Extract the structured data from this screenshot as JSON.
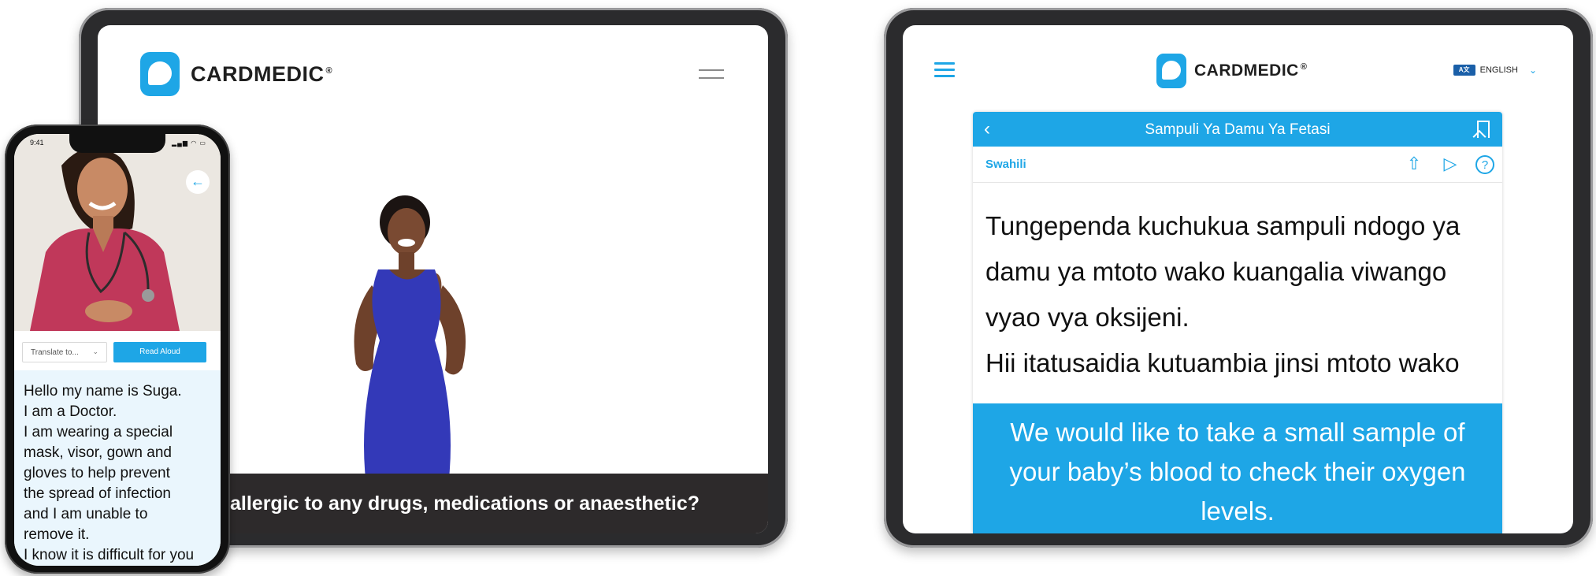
{
  "tablet_video": {
    "brand": "CARDMEDIC",
    "brand_mark": "®",
    "subtitle": "allergic to any drugs, medications or anaesthetic?"
  },
  "phone": {
    "status_time": "9:41",
    "status_icons": "▂▄▆ ◠ ▭",
    "translate_placeholder": "Translate to...",
    "read_aloud_label": "Read Aloud",
    "message_lines": [
      "Hello my name is Suga.",
      "I am a Doctor.",
      "I am wearing a special",
      "mask, visor, gown and",
      "gloves to help prevent",
      "the spread of infection",
      "and I am unable to",
      "remove it.",
      "I know it is difficult for you"
    ]
  },
  "tablet_translate": {
    "brand": "CARDMEDIC",
    "brand_mark": "®",
    "language_icon_text": "A文",
    "language_label": "ENGLISH",
    "card_title": "Sampuli Ya Damu Ya Fetasi",
    "card_language": "Swahili",
    "translated_lines": [
      "Tungependa kuchukua sampuli ndogo ya",
      "damu ya mtoto wako kuangalia viwango",
      "vyao vya oksijeni.",
      "Hii itatusaidia kutuambia jinsi mtoto wako"
    ],
    "english_text": "We would like to take a small sample of your baby’s blood to check their oxygen levels."
  },
  "colors": {
    "brand_blue": "#1ea6e6",
    "device_frame": "#2b2b2d",
    "subtitle_bar": "#2d2a2b"
  }
}
